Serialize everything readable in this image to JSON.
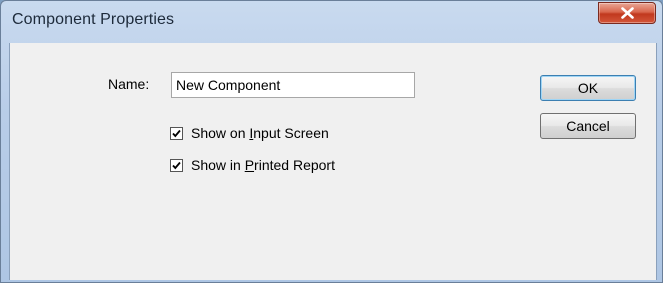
{
  "window": {
    "title": "Component Properties"
  },
  "form": {
    "name_label": "Name:",
    "name_value": "New Component",
    "checkbox_input_screen": {
      "before": "Show on ",
      "accel": "I",
      "after": "nput Screen",
      "checked": true
    },
    "checkbox_printed_report": {
      "before": "Show in ",
      "accel": "P",
      "after": "rinted Report",
      "checked": true
    }
  },
  "buttons": {
    "ok_label": "OK",
    "cancel_label": "Cancel"
  },
  "icons": {
    "close": "close-icon",
    "check": "check-icon"
  },
  "colors": {
    "close_button": "#d9664d",
    "titlebar": "#b8cde8",
    "dialog_background": "#f0f0f0"
  }
}
